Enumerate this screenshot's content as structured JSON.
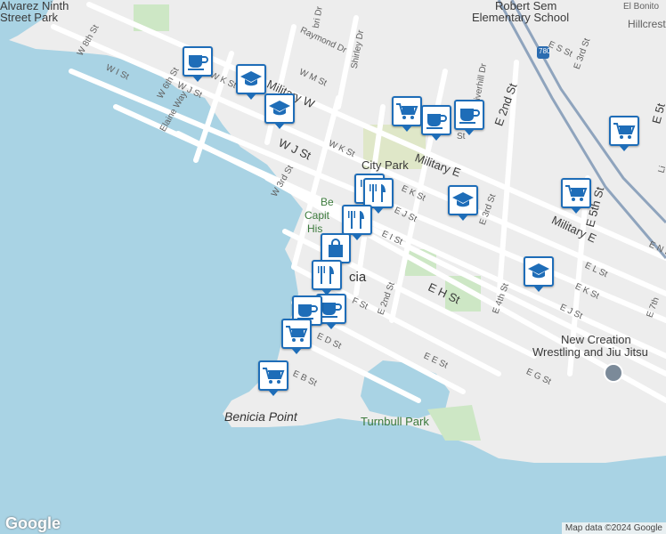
{
  "map": {
    "colors": {
      "water": "#a9d3e4",
      "land": "#ededed",
      "park": "#cde7c5",
      "road": "#ffffff",
      "highway": "#8fa4bd",
      "pin": "#1e6db8"
    },
    "labels": {
      "alvarez_park_1": "Alvarez Ninth",
      "alvarez_park_2": "Street Park",
      "school_1": "Robert Sem",
      "school_2": "Elementary School",
      "el_bonito": "El Bonito",
      "hillcrest": "Hillcrest",
      "w8th": "W 8th St",
      "wI": "W I St",
      "w6th": "W 6th St",
      "elaine": "Elaine Way",
      "wjst_small": "W J St",
      "wkst_top": "W K St",
      "raymond": "Raymond Dr",
      "shirley": "Shirley Dr",
      "bri": "bri Dr",
      "military_w": "Military W",
      "wmst": "W M St",
      "wjst": "W J St",
      "wkst": "W K St",
      "w3rd": "W 3rd St",
      "riverhill": "Riverhill Dr",
      "e2nd_top": "E 2nd St",
      "es_st": "E S St",
      "e3rd_top": "E 3rd St",
      "hwy": "780",
      "military_e": "Military E",
      "city_park": "City Park",
      "benicia_cap_1": "Be",
      "benicia_cap_2": "Capit",
      "benicia_cap_3": "His",
      "ek_st": "E K St",
      "ej_st": "E J St",
      "ei_st": "E I St",
      "e3rd": "E 3rd St",
      "military_e2": "Military E",
      "e5th": "E 5th St",
      "e5th_top": "E 5t",
      "en_st": "E N St",
      "el_st": "E L St",
      "ek_st2": "E K St",
      "ej_st2": "E J St",
      "e4th": "E 4th St",
      "eh_st": "E H St",
      "e2nd": "E 2nd St",
      "ef_st": "F St",
      "ed_st": "E D St",
      "ee_st": "E E St",
      "eg_st": "E G St",
      "eb_st": "E B St",
      "e7th": "E 7th",
      "benicia": "cia",
      "new_creation_1": "New Creation",
      "new_creation_2": "Wrestling and Jiu Jitsu",
      "benicia_point": "Benicia Point",
      "turnbull": "Turnbull Park",
      "li": "Li",
      "st_small": "St"
    },
    "pins": [
      {
        "name": "coffee-pin",
        "icon": "coffee"
      },
      {
        "name": "school-pin",
        "icon": "school"
      },
      {
        "name": "school-pin",
        "icon": "school"
      },
      {
        "name": "grocery-pin",
        "icon": "cart"
      },
      {
        "name": "coffee-pin",
        "icon": "coffee"
      },
      {
        "name": "coffee-pin",
        "icon": "coffee"
      },
      {
        "name": "grocery-pin",
        "icon": "cart"
      },
      {
        "name": "restaurant-pin",
        "icon": "food"
      },
      {
        "name": "restaurant-pin",
        "icon": "food"
      },
      {
        "name": "school-pin",
        "icon": "school"
      },
      {
        "name": "grocery-pin",
        "icon": "cart"
      },
      {
        "name": "restaurant-pin",
        "icon": "food"
      },
      {
        "name": "shopping-pin",
        "icon": "bag"
      },
      {
        "name": "restaurant-pin",
        "icon": "food"
      },
      {
        "name": "school-pin",
        "icon": "school"
      },
      {
        "name": "coffee-pin",
        "icon": "coffee"
      },
      {
        "name": "coffee-pin",
        "icon": "coffee"
      },
      {
        "name": "grocery-pin",
        "icon": "cart"
      },
      {
        "name": "grocery-pin",
        "icon": "cart"
      }
    ],
    "logo": "Google",
    "attribution": "Map data ©2024 Google"
  }
}
